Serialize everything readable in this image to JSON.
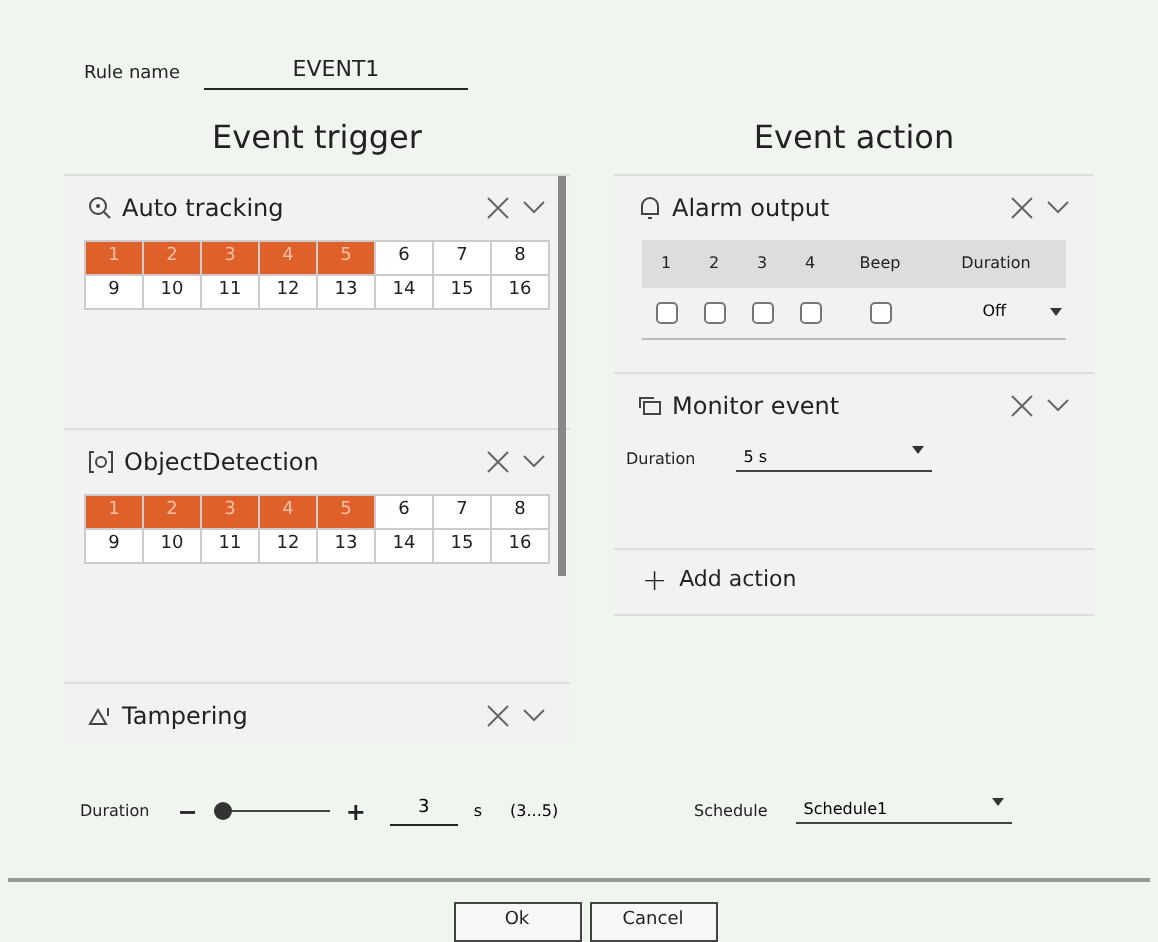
{
  "rule_name": {
    "label": "Rule name",
    "value": "EVENT1"
  },
  "trigger": {
    "title": "Event trigger",
    "panels": [
      {
        "kind": "channels",
        "title": "Auto tracking",
        "channels": [
          {
            "label": "1",
            "selected": true
          },
          {
            "label": "2",
            "selected": true
          },
          {
            "label": "3",
            "selected": true
          },
          {
            "label": "4",
            "selected": true
          },
          {
            "label": "5",
            "selected": true
          },
          {
            "label": "6",
            "selected": false
          },
          {
            "label": "7",
            "selected": false
          },
          {
            "label": "8",
            "selected": false
          },
          {
            "label": "9",
            "selected": false
          },
          {
            "label": "10",
            "selected": false
          },
          {
            "label": "11",
            "selected": false
          },
          {
            "label": "12",
            "selected": false
          },
          {
            "label": "13",
            "selected": false
          },
          {
            "label": "14",
            "selected": false
          },
          {
            "label": "15",
            "selected": false
          },
          {
            "label": "16",
            "selected": false
          }
        ]
      },
      {
        "kind": "channels",
        "title": "ObjectDetection",
        "channels": [
          {
            "label": "1",
            "selected": true
          },
          {
            "label": "2",
            "selected": true
          },
          {
            "label": "3",
            "selected": true
          },
          {
            "label": "4",
            "selected": true
          },
          {
            "label": "5",
            "selected": true
          },
          {
            "label": "6",
            "selected": false
          },
          {
            "label": "7",
            "selected": false
          },
          {
            "label": "8",
            "selected": false
          },
          {
            "label": "9",
            "selected": false
          },
          {
            "label": "10",
            "selected": false
          },
          {
            "label": "11",
            "selected": false
          },
          {
            "label": "12",
            "selected": false
          },
          {
            "label": "13",
            "selected": false
          },
          {
            "label": "14",
            "selected": false
          },
          {
            "label": "15",
            "selected": false
          },
          {
            "label": "16",
            "selected": false
          }
        ]
      },
      {
        "kind": "collapsed",
        "title": "Tampering"
      }
    ],
    "duration": {
      "label": "Duration",
      "minus": "−",
      "plus": "+",
      "level": 0.0,
      "value": "3",
      "unit": "s",
      "range": "(3...5)"
    }
  },
  "action": {
    "title": "Event action",
    "alarm": {
      "title": "Alarm output",
      "columns": [
        "1",
        "2",
        "3",
        "4",
        "Beep",
        "Duration"
      ],
      "checks": [
        {
          "checked": false
        },
        {
          "checked": false
        },
        {
          "checked": false
        },
        {
          "checked": false
        },
        {
          "checked": false
        }
      ],
      "duration": "Off"
    },
    "monitor": {
      "title": "Monitor event",
      "label": "Duration",
      "value": "5 s"
    },
    "add": {
      "plus": "+",
      "label": "Add action"
    },
    "schedule": {
      "label": "Schedule",
      "value": "Schedule1"
    }
  },
  "buttons": [
    "Ok",
    "Cancel"
  ]
}
